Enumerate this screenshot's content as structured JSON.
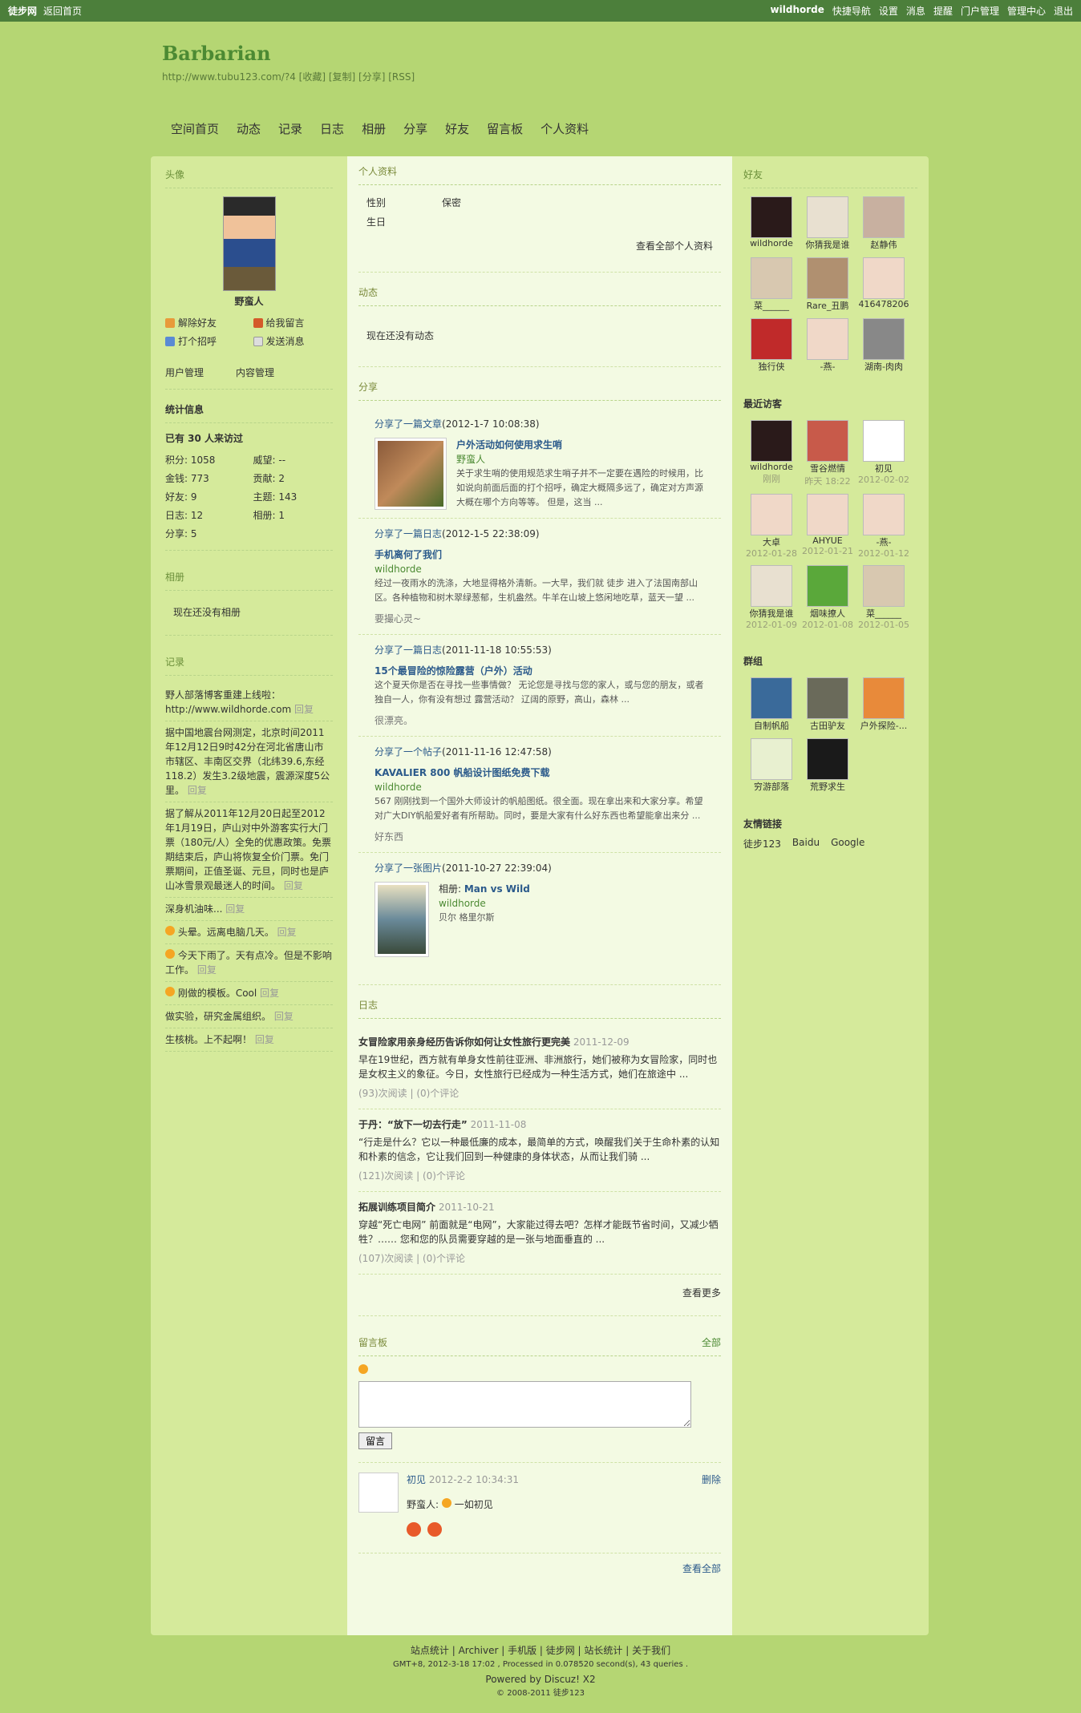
{
  "topbar": {
    "site": "徒步网",
    "home": "返回首页",
    "user": "wildhorde",
    "nav": "快捷导航",
    "links": [
      "设置",
      "消息",
      "提醒",
      "门户管理",
      "管理中心",
      "退出"
    ]
  },
  "header": {
    "title": "Barbarian",
    "links": "http://www.tubu123.com/?4 [收藏] [复制] [分享] [RSS]"
  },
  "nav": [
    "空间首页",
    "动态",
    "记录",
    "日志",
    "相册",
    "分享",
    "好友",
    "留言板",
    "个人资料"
  ],
  "left": {
    "avatar_h": "头像",
    "name": "野蛮人",
    "actions": [
      "解除好友",
      "给我留言",
      "打个招呼",
      "发送消息"
    ],
    "mgr": [
      "用户管理",
      "内容管理"
    ],
    "stat_h": "统计信息",
    "visit": "已有 30 人来访过",
    "stats": [
      "积分: 1058",
      "威望: --",
      "金钱: 773",
      "贡献: 2",
      "好友: 9",
      "主题: 143",
      "日志: 12",
      "相册: 1",
      "分享: 5"
    ],
    "album_h": "相册",
    "album_empty": "现在还没有相册",
    "rec_h": "记录",
    "records": [
      {
        "t": "野人部落博客重建上线啦：http://www.wildhorde.com",
        "r": "回复"
      },
      {
        "t": "据中国地震台网测定，北京时间2011年12月12日9时42分在河北省唐山市市辖区、丰南区交界（北纬39.6,东经118.2）发生3.2级地震，震源深度5公里。",
        "r": "回复"
      },
      {
        "t": "据了解从2011年12月20日起至2012年1月19日，庐山对中外游客实行大门票（180元/人）全免的优惠政策。免票期结束后，庐山将恢复全价门票。免门票期间，正值圣诞、元旦，同时也是庐山冰雪景观最迷人的时间。",
        "r": "回复"
      },
      {
        "t": "深身机油味...",
        "r": "回复"
      },
      {
        "t": "头晕。远离电脑几天。",
        "r": "回复"
      },
      {
        "t": "今天下雨了。天有点冷。但是不影响工作。",
        "r": "回复"
      },
      {
        "t": "刚做的模板。Cool",
        "r": "回复"
      },
      {
        "t": "做实验，研究金属组织。",
        "r": "回复"
      },
      {
        "t": "生核桃。上不起啊！",
        "r": "回复"
      }
    ]
  },
  "center": {
    "profile_h": "个人资料",
    "gender_k": "性别",
    "gender_v": "保密",
    "birth": "生日",
    "profile_all": "查看全部个人资料",
    "feed_h": "动态",
    "feed_empty": "现在还没有动态",
    "share_h": "分享",
    "shares": [
      {
        "h": "分享了一篇文章",
        "d": "(2012-1-7 10:08:38)",
        "title": "户外活动如何使用求生哨",
        "by": "野蛮人",
        "desc": "关于求生哨的使用规范求生哨子并不一定要在遇险的时候用，比如说向前面后面的打个招呼，确定大概隔多远了，确定对方声源大概在哪个方向等等。 但是，这当 ...",
        "q": ""
      },
      {
        "h": "分享了一篇日志",
        "d": "(2012-1-5 22:38:09)",
        "title": "手机离何了我们",
        "by": "wildhorde",
        "desc": "经过一夜雨水的洗涤，大地显得格外清新。一大早，我们就 徒步 进入了法国南部山区。各种植物和树木翠绿葱郁，生机盎然。牛羊在山坡上悠闲地吃草，蓝天一望 ...",
        "q": "要撮心灵~"
      },
      {
        "h": "分享了一篇日志",
        "d": "(2011-11-18 10:55:53)",
        "title": "15个最冒险的惊险露营（户外）活动",
        "by": "",
        "desc": "这个夏天你是否在寻找一些事情做？ 无论您是寻找与您的家人，或与您的朋友，或者独自一人，你有没有想过 露营活动？ 辽阔的原野，高山，森林 ...",
        "q": "很漂亮。"
      },
      {
        "h": "分享了一个帖子",
        "d": "(2011-11-16 12:47:58)",
        "title": "KAVALIER 800 帆船设计图纸免费下载",
        "by": "wildhorde",
        "desc": "567 刚刚找到一个国外大师设计的帆船图纸。很全面。现在拿出来和大家分享。希望对广大DIY帆船爱好者有所帮助。同时，要是大家有什么好东西也希望能拿出来分 ...",
        "q": "好东西"
      },
      {
        "h": "分享了一张图片",
        "d": "(2011-10-27 22:39:04)",
        "album": "相册: ",
        "title": "Man vs Wild",
        "by": "wildhorde",
        "desc": "贝尔 格里尔斯",
        "q": ""
      }
    ],
    "blog_h": "日志",
    "blogs": [
      {
        "t": "女冒险家用亲身经历告诉你如何让女性旅行更完美",
        "d": "2011-12-09",
        "c": "早在19世纪，西方就有单身女性前往亚洲、非洲旅行，她们被称为女冒险家，同时也是女权主义的象征。今日，女性旅行已经成为一种生活方式，她们在旅途中 ...",
        "v": "(93)次阅读",
        "cm": "(0)个评论"
      },
      {
        "t": "于丹：“放下一切去行走”",
        "d": "2011-11-08",
        "c": "“行走是什么？它以一种最低廉的成本，最简单的方式，唤醒我们关于生命朴素的认知和朴素的信念，它让我们回到一种健康的身体状态，从而让我们骑 ...",
        "v": "(121)次阅读",
        "cm": "(0)个评论"
      },
      {
        "t": "拓展训练项目简介",
        "d": "2011-10-21",
        "c": "穿越“死亡电网” 前面就是“电网”，大家能过得去吧？怎样才能既节省时间，又减少牺牲？…… 您和您的队员需要穿越的是一张与地面垂直的 ...",
        "v": "(107)次阅读",
        "cm": "(0)个评论"
      }
    ],
    "blog_more": "查看更多",
    "msg_h": "留言板",
    "msg_all": "全部",
    "msg_btn": "留言",
    "msg_name": "初见",
    "msg_time": "2012-2-2 10:34:31",
    "msg_del": "删除",
    "msg_reply_n": "野蛮人:",
    "msg_reply": "一如初见",
    "msg_more": "查看全部"
  },
  "right": {
    "friends_h": "好友",
    "friends": [
      "wildhorde",
      "你猜我是谁",
      "赵静伟",
      "菜______",
      "Rare_丑鹏",
      "416478206",
      "独行侠",
      "-燕-",
      "湖南-肉肉"
    ],
    "visit_h": "最近访客",
    "visitors": [
      [
        "wildhorde",
        "刚刚"
      ],
      [
        "雪谷燃情",
        "昨天 18:22"
      ],
      [
        "初见",
        "2012-02-02"
      ],
      [
        "大卓",
        "2012-01-28"
      ],
      [
        "AHYUE",
        "2012-01-21"
      ],
      [
        "-燕-",
        "2012-01-12"
      ],
      [
        "你猜我是谁",
        "2012-01-09"
      ],
      [
        "烟味撩人",
        "2012-01-08"
      ],
      [
        "菜______",
        "2012-01-05"
      ]
    ],
    "group_h": "群组",
    "groups": [
      "自制帆船",
      "古田驴友",
      "户外探险-...",
      "穷游部落",
      "荒野求生"
    ],
    "link_h": "友情链接",
    "links": [
      "徒步123",
      "Baidu",
      "Google"
    ]
  },
  "footer": {
    "l1": "站点统计 | Archiver | 手机版 | 徒步网 | 站长统计 | 关于我们",
    "l2": "GMT+8, 2012-3-18 17:02 , Processed in 0.078520 second(s), 43 queries .",
    "l3": "Powered by Discuz! X2",
    "l4": "© 2008-2011 徒步123"
  }
}
